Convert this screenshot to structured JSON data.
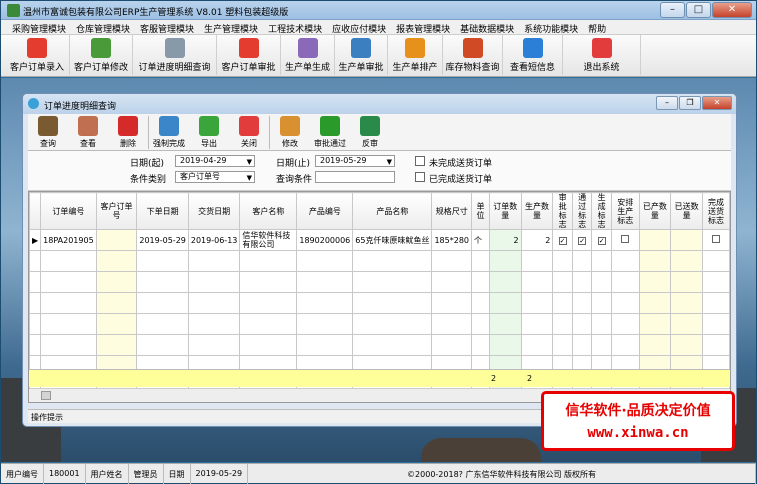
{
  "window": {
    "title": "温州市富诚包装有限公司ERP生产管理系统  V8.01 塑料包装超级版"
  },
  "menu": [
    "采购管理模块",
    "仓库管理模块",
    "客服管理模块",
    "生产管理模块",
    "工程技术模块",
    "应收应付模块",
    "报表管理模块",
    "基础数据模块",
    "系统功能模块",
    "帮助"
  ],
  "toolbar": [
    {
      "label": "客户订单录入",
      "icon": "pdf-icon",
      "color": "#e43c2e"
    },
    {
      "label": "客户订单修改",
      "icon": "edit-plant-icon",
      "color": "#4a9a3a"
    },
    {
      "label": "订单进度明细查询",
      "icon": "document-icon",
      "color": "#8899aa"
    },
    {
      "label": "客户订单审批",
      "icon": "approve-icon",
      "color": "#e43c2e"
    },
    {
      "label": "生产单生成",
      "icon": "generate-icon",
      "color": "#8a6ab8"
    },
    {
      "label": "生产单审批",
      "icon": "check-doc-icon",
      "color": "#3b7fc1"
    },
    {
      "label": "生产单排产",
      "icon": "flower-icon",
      "color": "#e8901c"
    },
    {
      "label": "库存物料查询",
      "icon": "pens-icon",
      "color": "#d14a26"
    },
    {
      "label": "查看短信息",
      "icon": "feather-icon",
      "color": "#2c7fd6"
    },
    {
      "label": "退出系统",
      "icon": "power-icon",
      "color": "#e23c3c"
    }
  ],
  "child": {
    "title": "订单进度明细查询",
    "tools": [
      {
        "label": "查询",
        "icon": "magnifier-icon",
        "color": "#7a5a30"
      },
      {
        "label": "查看",
        "icon": "view-icon",
        "color": "#c07050"
      },
      {
        "label": "删除",
        "icon": "delete-x-icon",
        "color": "#d42a2a"
      },
      {
        "label": "强制完成",
        "icon": "force-complete-icon",
        "color": "#3b86c8"
      },
      {
        "label": "导出",
        "icon": "export-arrow-icon",
        "color": "#3aa53a"
      },
      {
        "label": "关闭",
        "icon": "close-power-icon",
        "color": "#e23c3c"
      },
      {
        "label": "修改",
        "icon": "modify-icon",
        "color": "#d89030"
      },
      {
        "label": "审批通过",
        "icon": "checkmark-icon",
        "color": "#2a9a2a"
      },
      {
        "label": "反审",
        "icon": "reverse-icon",
        "color": "#2a8a4a"
      }
    ],
    "filters": {
      "date_from_label": "日期(起)",
      "date_from": "2019-04-29",
      "date_to_label": "日期(止)",
      "date_to": "2019-05-29",
      "cond_type_label": "条件类别",
      "cond_type": "客户订单号",
      "cond_label": "查询条件",
      "cond_value": "",
      "chk_unfinished": "未完成送货订单",
      "chk_finished": "已完成送货订单"
    },
    "columns": [
      "订单编号",
      "客户订单号",
      "下单日期",
      "交货日期",
      "客户名称",
      "产品编号",
      "产品名称",
      "规格尺寸",
      "单位",
      "订单数量",
      "生产数量",
      "审批标志",
      "通过标志",
      "生成标志",
      "安排生产标志",
      "已产数量",
      "已送数量",
      "完成送货标志"
    ],
    "rows": [
      [
        "18PA201905",
        "",
        "2019-05-29",
        "2019-06-13",
        "信华软件科技有限公司",
        "1890200006",
        "65克仟味原味鱿鱼丝",
        "185*280",
        "个",
        "2",
        "2",
        "✓",
        "✓",
        "✓",
        "",
        "",
        "",
        ""
      ]
    ],
    "sum": {
      "order_qty": "2",
      "prod_qty": "2"
    },
    "op_hint": "操作提示"
  },
  "promo": {
    "line1": "信华软件·品质决定价值",
    "line2": "www.xinwa.cn"
  },
  "status": [
    {
      "label": "用户编号"
    },
    {
      "label": "180001"
    },
    {
      "label": "用户姓名"
    },
    {
      "label": "管理员"
    },
    {
      "label": "日期"
    },
    {
      "label": "2019-05-29"
    },
    {
      "label": "©2000-2018?  广东信华软件科技有限公司  版权所有"
    }
  ]
}
